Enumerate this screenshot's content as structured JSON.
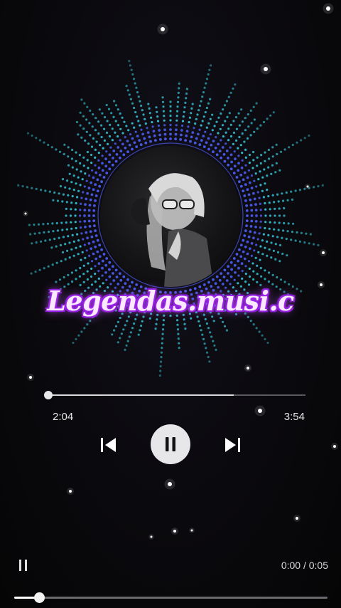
{
  "player": {
    "elapsed": "2:04",
    "total": "3:54",
    "progress": 0.0,
    "buffered": 0.72
  },
  "watermark": "Legendas.musi.c",
  "controls": {
    "prev_icon": "skip-previous-icon",
    "play_icon": "pause-icon",
    "next_icon": "skip-next-icon"
  },
  "video_bar": {
    "play_icon": "pause-icon",
    "time": "0:00 / 0:05",
    "progress": 0.08
  },
  "colors": {
    "visualizer_outer": "#38d6e8",
    "visualizer_inner": "#4b5cf0",
    "accent_text": "#a020f0",
    "button_bg": "#e7e7ea"
  }
}
